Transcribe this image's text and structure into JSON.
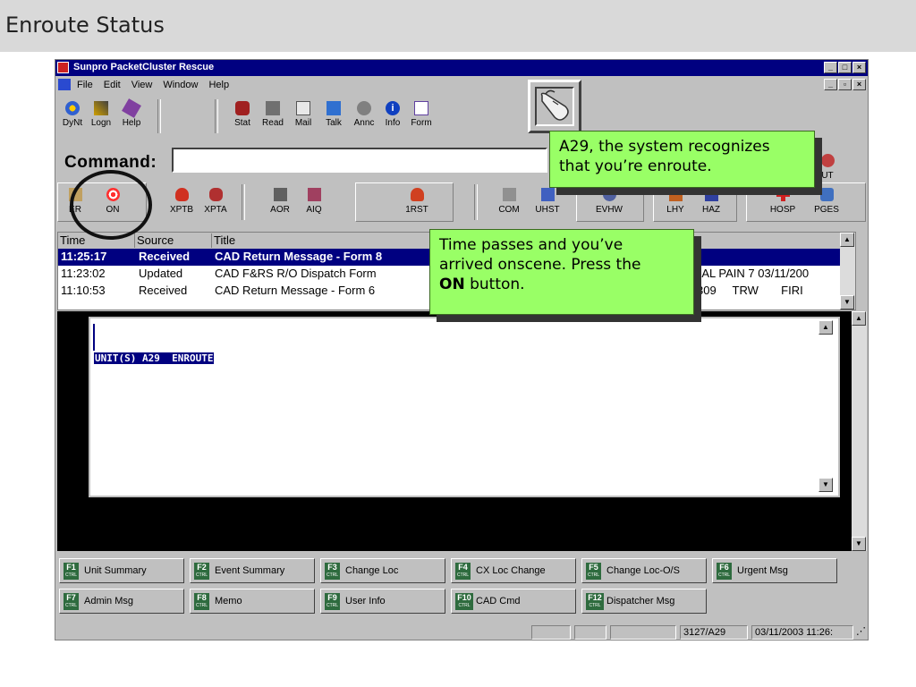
{
  "slide": {
    "title": "Enroute Status"
  },
  "app": {
    "title": "Sunpro PacketCluster Rescue",
    "menu": [
      "File",
      "Edit",
      "View",
      "Window",
      "Help"
    ],
    "toolbar1": [
      "DyNt",
      "Logn",
      "Help",
      "Stat",
      "Read",
      "Mail",
      "Talk",
      "Annc",
      "Info",
      "Form"
    ],
    "command_label": "Command:",
    "command_value": "",
    "toolbar2": [
      "ER",
      "ON",
      "XPTB",
      "XPTA",
      "AOR",
      "AIQ",
      "1RST",
      "COM",
      "UHST",
      "EVHW",
      "LHY",
      "HAZ",
      "HOSP",
      "PGES"
    ],
    "toolbar2_right_partial": "UT",
    "table": {
      "headers": [
        "Time",
        "Source",
        "Title"
      ],
      "rows": [
        {
          "time": "11:25:17",
          "source": "Received",
          "title": "CAD Return Message - Form 8",
          "extra": ""
        },
        {
          "time": "11:23:02",
          "source": "Updated",
          "title": "CAD F&RS R/O Dispatch Form",
          "extra": "NAL PAIN 7 03/11/200"
        },
        {
          "time": "11:10:53",
          "source": "Received",
          "title": "CAD Return Message - Form 6",
          "extra": "309     TRW       FIRI"
        }
      ]
    },
    "message_text": "UNIT(S) A29  ENROUTE",
    "fkeys": [
      {
        "key": "F1",
        "label": "Unit Summary"
      },
      {
        "key": "F2",
        "label": "Event Summary"
      },
      {
        "key": "F3",
        "label": "Change Loc"
      },
      {
        "key": "F4",
        "label": "CX Loc Change"
      },
      {
        "key": "F5",
        "label": "Change Loc-O/S"
      },
      {
        "key": "F6",
        "label": "Urgent Msg"
      },
      {
        "key": "F7",
        "label": "Admin Msg"
      },
      {
        "key": "F8",
        "label": "Memo"
      },
      {
        "key": "F9",
        "label": "User Info"
      },
      {
        "key": "F10",
        "label": "CAD Cmd"
      },
      {
        "key": "F12",
        "label": "Dispatcher Msg"
      }
    ],
    "fkey_ctrl": "CTRL",
    "status": {
      "unit": "3127/A29",
      "datetime": "03/11/2003 11:26:"
    }
  },
  "callouts": {
    "enroute_line1": "A29, the system recognizes",
    "enroute_line2": "that you’re enroute.",
    "onscene_line1": "Time passes and you’ve",
    "onscene_line2": "arrived onscene. Press the",
    "onscene_bold": "ON",
    "onscene_tail": " button."
  },
  "colors": {
    "titlebar": "#000080",
    "callout": "#99ff66",
    "selection": "#000080"
  }
}
